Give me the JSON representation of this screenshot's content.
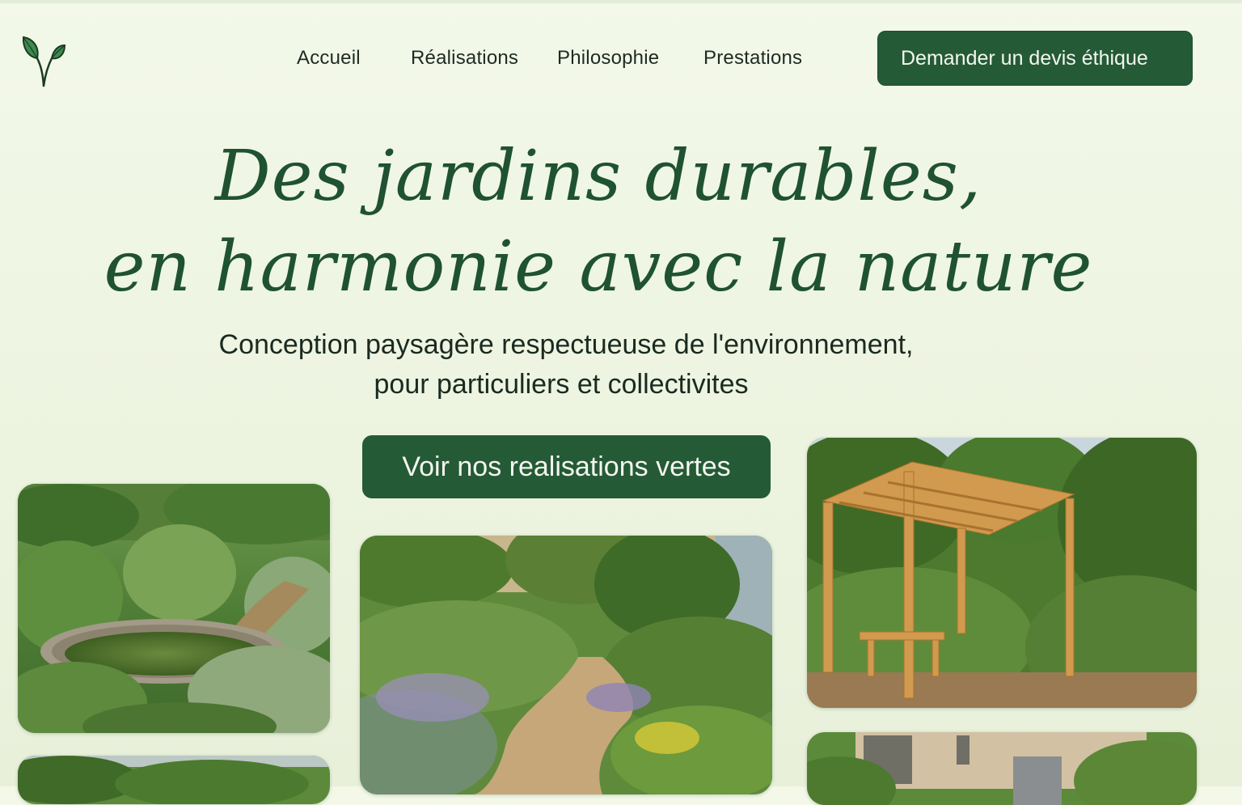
{
  "nav": {
    "items": [
      "Accueil",
      "Réalisations",
      "Philosophie",
      "Prestations"
    ],
    "cta_label": "Demander un devis éthique"
  },
  "hero": {
    "title_line1": "Des jardins durables,",
    "title_line2": "en harmonie avec la nature",
    "subtitle_line1": "Conception paysagère respectueuse de l'environnement,",
    "subtitle_line2": "pour particuliers et collectivites",
    "cta_label": "Voir nos realisations vertes"
  },
  "colors": {
    "brand_green": "#255a36",
    "title_green": "#1f5231",
    "background": "#f3f8e9"
  },
  "icons": {
    "logo": "sprout-icon"
  }
}
